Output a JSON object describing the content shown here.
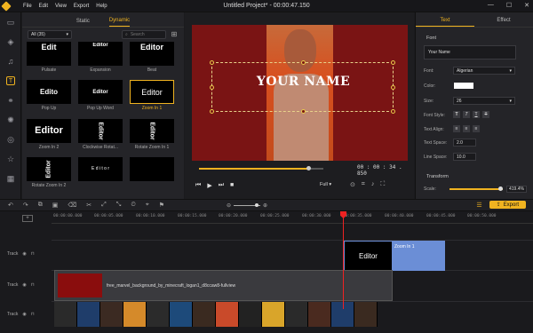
{
  "app": {
    "title": "Untitled Project* - 00:00:47.150",
    "menu": [
      "File",
      "Edit",
      "View",
      "Export",
      "Help"
    ],
    "window_controls": [
      "—",
      "☐",
      "✕"
    ],
    "accent_color": "#f0b320"
  },
  "left_toolbar": {
    "icons": [
      "media-icon",
      "layers-icon",
      "audio-icon",
      "text-icon",
      "transition-icon",
      "effects-icon",
      "filter-icon",
      "sticker-icon",
      "template-icon"
    ]
  },
  "library": {
    "tabs": [
      "Static",
      "Dynamic"
    ],
    "active_tab": "Dynamic",
    "filter_value": "All (35)",
    "search_placeholder": "Search",
    "presets": [
      {
        "thumb": "Edit",
        "name": "Pulsate"
      },
      {
        "thumb": "Editor",
        "name": "Expansion"
      },
      {
        "thumb": "Editor",
        "name": "Beat"
      },
      {
        "thumb": "Edito",
        "name": "Pop Up"
      },
      {
        "thumb": "Editor",
        "name": "Pop Up Word"
      },
      {
        "thumb": "Editor",
        "name": "Zoom In 1"
      },
      {
        "thumb": "Editor",
        "name": "Zoom In 2"
      },
      {
        "thumb": "Editor",
        "name": "Clockwise Rotat..."
      },
      {
        "thumb": "Editor",
        "name": "Rotate Zoom In 1"
      },
      {
        "thumb": "Editor",
        "name": "Rotate Zoom In 2"
      },
      {
        "thumb": "E d i t o r",
        "name": ""
      },
      {
        "thumb": "",
        "name": ""
      }
    ]
  },
  "player": {
    "overlay_text": "YOUR NAME",
    "timecode": "00 : 00 : 34 . 850",
    "progress": 0.88,
    "quality": "Full"
  },
  "properties": {
    "tabs": [
      "Text",
      "Effect"
    ],
    "active_tab": "Text",
    "font_section": "Font",
    "text_value": "Your Name",
    "font_label": "Font:",
    "font_value": "Algerian",
    "color_label": "Color:",
    "color_value": "#ffffff",
    "size_label": "Size:",
    "size_value": "26",
    "style_label": "Font Style:",
    "style_buttons": [
      "T",
      "T",
      "T",
      "T"
    ],
    "align_label": "Text Align:",
    "align_buttons": [
      "≡",
      "≡",
      "≡"
    ],
    "text_space_label": "Text Space:",
    "text_space_value": "2.0",
    "line_space_label": "Line Space:",
    "line_space_value": "10.0",
    "transform_section": "Transform",
    "scale_label": "Scale:",
    "scale_value": "419.4%"
  },
  "toolbar": {
    "tools": [
      "↶",
      "↷",
      "⧉",
      "▣",
      "⌫",
      "✂",
      "⤢",
      "⤡",
      "⏲",
      "⌖",
      "⚑",
      "◌",
      "⟲"
    ],
    "zoom_minus": "⊖",
    "zoom_plus": "⊕",
    "export_label": "Export"
  },
  "timeline": {
    "ruler": [
      "00:00:00.000",
      "00:00:05.000",
      "00:00:10.000",
      "00:00:15.000",
      "00:00:20.000",
      "00:00:25.000",
      "00:00:30.000",
      "00:00:35.000",
      "00:00:40.000",
      "00:00:45.000",
      "00:00:50.000"
    ],
    "tracks": [
      {
        "label": "Track"
      },
      {
        "label": "Track"
      },
      {
        "label": "Track"
      }
    ],
    "text_clip": {
      "thumb": "Editor",
      "label": "Zoom In 1"
    },
    "bg_clip": {
      "label": "free_marvel_background_by_minecraft_logan1_d8ccaw8-fullview"
    },
    "strip_colors": [
      "#2a2a2a",
      "#1f3d6a",
      "#3b2a22",
      "#d58a2a",
      "#2b2b2b",
      "#1d4a7a",
      "#3a2a20",
      "#c94a2a",
      "#222",
      "#d9a52a",
      "#2a2a2a",
      "#4a2a1f",
      "#1f3d6a",
      "#3a2a20"
    ]
  }
}
